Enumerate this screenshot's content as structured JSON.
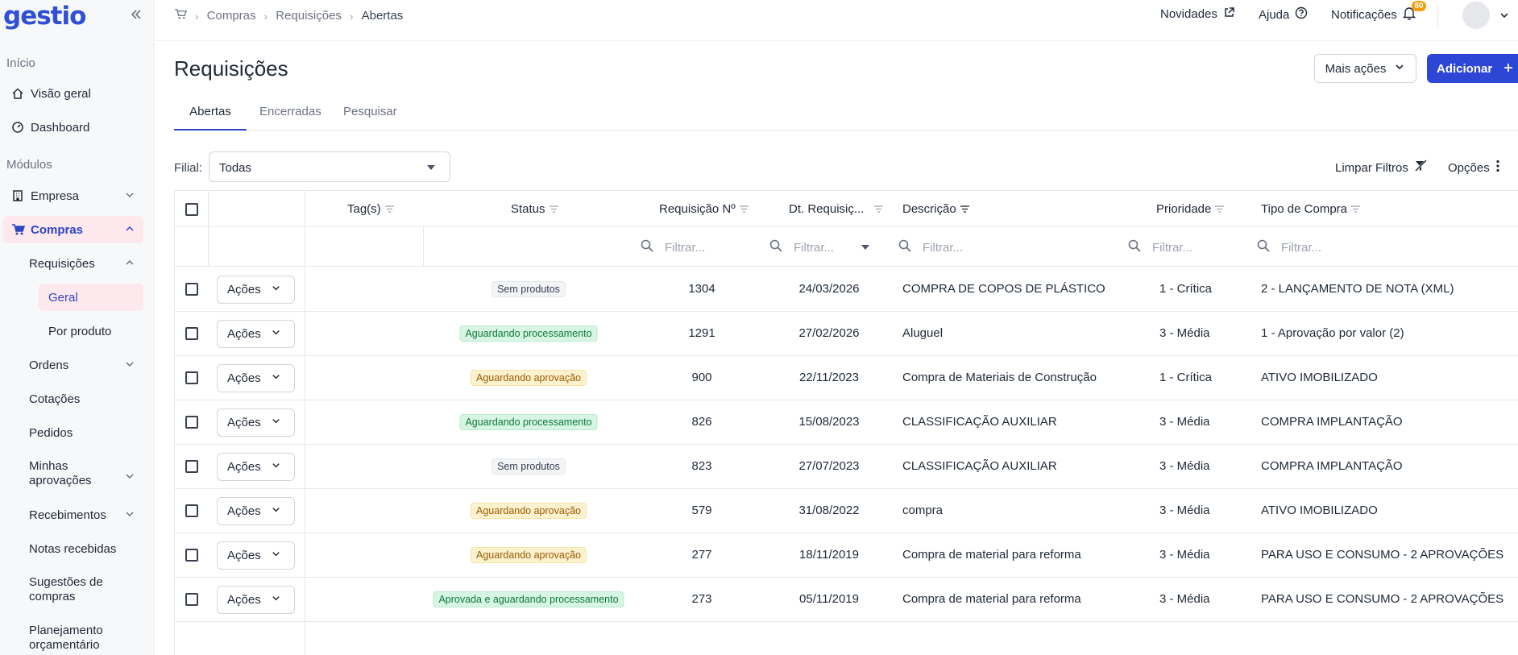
{
  "brand": {
    "logo_text": "gestio"
  },
  "sidebar": {
    "section_inicio": "Início",
    "section_modulos": "Módulos",
    "visao_geral": "Visão geral",
    "dashboard": "Dashboard",
    "empresa": "Empresa",
    "compras": "Compras",
    "requisicoes": "Requisições",
    "geral": "Geral",
    "por_produto": "Por produto",
    "ordens": "Ordens",
    "cotacoes": "Cotações",
    "pedidos": "Pedidos",
    "minhas_aprovacoes": "Minhas aprovações",
    "recebimentos": "Recebimentos",
    "notas_recebidas": "Notas recebidas",
    "sugestoes_de_compras": "Sugestões de compras",
    "planejamento_orcamentario": "Planejamento orçamentário"
  },
  "breadcrumb": {
    "compras": "Compras",
    "requisicoes": "Requisições",
    "abertas": "Abertas"
  },
  "topbar": {
    "novidades": "Novidades",
    "ajuda": "Ajuda",
    "notificacoes": "Notificações",
    "notif_count": "80"
  },
  "header": {
    "title": "Requisições",
    "more_actions": "Mais ações",
    "add": "Adicionar"
  },
  "tabs": {
    "abertas": "Abertas",
    "encerradas": "Encerradas",
    "pesquisar": "Pesquisar"
  },
  "filters": {
    "filial_label": "Filial:",
    "filial_value": "Todas",
    "clear": "Limpar Filtros",
    "options": "Opções"
  },
  "table": {
    "columns": {
      "tags": "Tag(s)",
      "status": "Status",
      "requisicao": "Requisição Nº",
      "dt_requisicao": "Dt. Requisiç...",
      "descricao": "Descrição",
      "prioridade": "Prioridade",
      "tipo_compra": "Tipo de Compra"
    },
    "filter_placeholder": "Filtrar...",
    "actions_label": "Ações",
    "rows": [
      {
        "status": "Sem produtos",
        "status_color": "gray",
        "numero": "1304",
        "data": "24/03/2026",
        "descricao": "COMPRA DE COPOS DE PLÁSTICO",
        "prioridade": "1 - Crítica",
        "tipo": "2 - LANÇAMENTO DE NOTA (XML)"
      },
      {
        "status": "Aguardando processamento",
        "status_color": "green",
        "numero": "1291",
        "data": "27/02/2026",
        "descricao": "Aluguel",
        "prioridade": "3 - Média",
        "tipo": "1 - Aprovação por valor (2)"
      },
      {
        "status": "Aguardando aprovação",
        "status_color": "yellow",
        "numero": "900",
        "data": "22/11/2023",
        "descricao": "Compra de Materiais de Construção",
        "prioridade": "1 - Crítica",
        "tipo": "ATIVO IMOBILIZADO"
      },
      {
        "status": "Aguardando processamento",
        "status_color": "green",
        "numero": "826",
        "data": "15/08/2023",
        "descricao": "CLASSIFICAÇÃO AUXILIAR",
        "prioridade": "3 - Média",
        "tipo": "COMPRA IMPLANTAÇÃO"
      },
      {
        "status": "Sem produtos",
        "status_color": "gray",
        "numero": "823",
        "data": "27/07/2023",
        "descricao": "CLASSIFICAÇÃO AUXILIAR",
        "prioridade": "3 - Média",
        "tipo": "COMPRA IMPLANTAÇÃO"
      },
      {
        "status": "Aguardando aprovação",
        "status_color": "yellow",
        "numero": "579",
        "data": "31/08/2022",
        "descricao": "compra",
        "prioridade": "3 - Média",
        "tipo": "ATIVO IMOBILIZADO"
      },
      {
        "status": "Aguardando aprovação",
        "status_color": "yellow",
        "numero": "277",
        "data": "18/11/2019",
        "descricao": "Compra de material para reforma",
        "prioridade": "3 - Média",
        "tipo": "PARA USO E CONSUMO - 2 APROVAÇÕES"
      },
      {
        "status": "Aprovada e aguardando processamento",
        "status_color": "green",
        "numero": "273",
        "data": "05/11/2019",
        "descricao": "Compra de material para reforma",
        "prioridade": "3 - Média",
        "tipo": "PARA USO E CONSUMO - 2 APROVAÇÕES"
      }
    ]
  },
  "colors": {
    "accent": "#2d46d6",
    "active_bg": "#fde8ee",
    "badge_orange": "#f59e0b"
  }
}
